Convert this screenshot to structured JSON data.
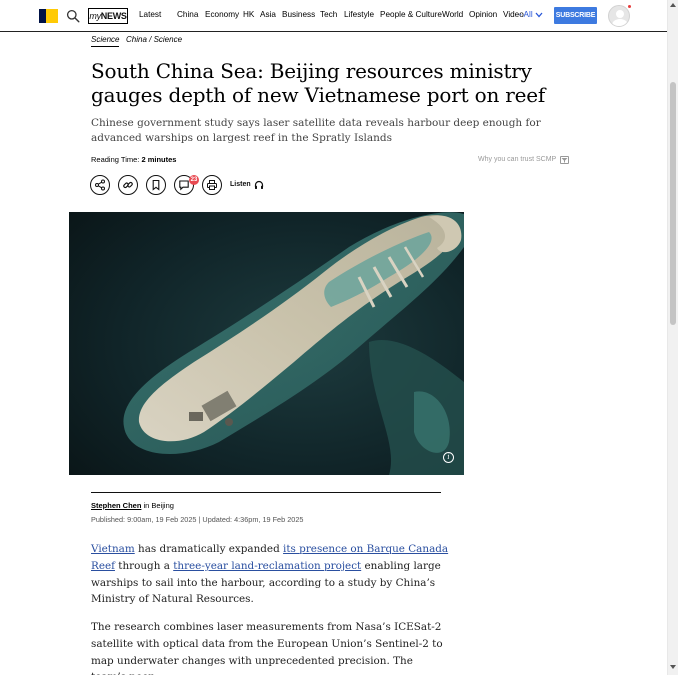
{
  "header": {
    "mynews_label_prefix": "my",
    "mynews_label_suffix": "NEWS",
    "nav_items": [
      "Latest",
      "China",
      "Economy",
      "HK",
      "Asia",
      "Business",
      "Tech",
      "Lifestyle",
      "People & Culture",
      "World",
      "Opinion",
      "Video"
    ],
    "all_label": "- All",
    "subscribe_label": "SUBSCRIBE",
    "accent_color": "#3d7ae0"
  },
  "article": {
    "section": "Science",
    "subsection": "China / Science",
    "headline": "South China Sea: Beijing resources ministry gauges depth of new Vietnamese port on reef",
    "standfirst": "Chinese government study says laser satellite data reveals harbour deep enough for advanced warships on largest reef in the Spratly Islands",
    "reading_time_label": "Reading Time:",
    "reading_time_value": "2 minutes",
    "trust_label": "Why you can trust SCMP",
    "comment_count": "23",
    "listen_label": "Listen",
    "image_info_glyph": "i",
    "author": "Stephen Chen",
    "location_text": " in Beijing",
    "dates": "Published: 9:00am, 19 Feb 2025 | Updated: 4:36pm, 19 Feb 2025",
    "body": {
      "p1": {
        "link1": "Vietnam",
        "text1": " has dramatically expanded ",
        "link2": "its presence on Barque Canada Reef",
        "text2": " through a ",
        "link3": "three-year land-reclamation project",
        "text3": " enabling large warships to sail into the harbour, according to a study by China’s Ministry of Natural Resources."
      },
      "p2": "The research combines laser measurements from Nasa’s ICESat-2 satellite with optical data from the European Union’s Sentinel-2 to map underwater changes with unprecedented precision. The team’s peer-"
    }
  },
  "icons": [
    "search-icon",
    "share-icon",
    "link-icon",
    "bookmark-icon",
    "comment-icon",
    "print-icon",
    "headphones-icon",
    "chevron-down-icon",
    "info-icon",
    "filter-icon"
  ]
}
